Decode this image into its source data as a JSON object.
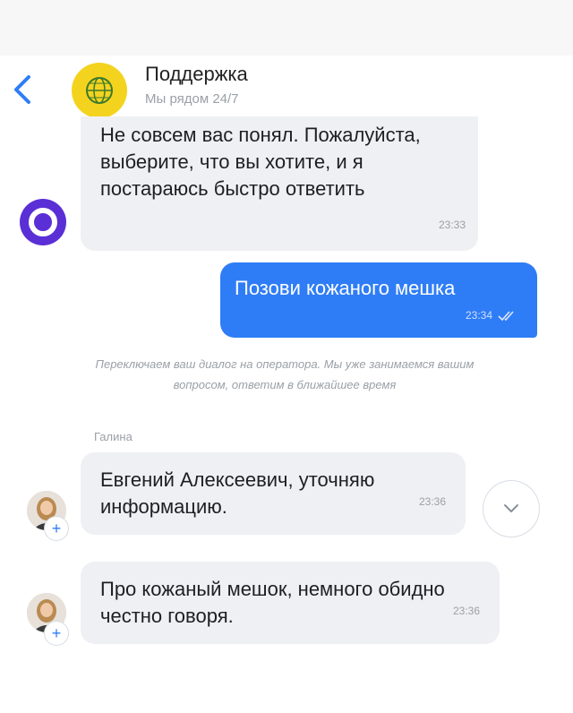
{
  "header": {
    "title": "Поддержка",
    "subtitle": "Мы рядом 24/7"
  },
  "messages": [
    {
      "text": "Не совсем вас понял. Пожалуйста, выберите, что вы хотите, и я постараюсь быстро ответить",
      "time": "23:33"
    },
    {
      "text": "Позови кожаного мешка",
      "time": "23:34"
    },
    {
      "text": "Евгений Алексеевич, уточняю информацию.",
      "time": "23:36"
    },
    {
      "text": "Про кожаный мешок, немного обидно честно говоря.",
      "time": "23:36"
    }
  ],
  "system_note": "Переключаем ваш диалог на оператора. Мы уже занимаемся вашим вопросом, ответим в ближайшее время",
  "operator": {
    "name": "Галина",
    "badge": "+"
  },
  "bot_badge": "O",
  "colors": {
    "accent": "#2f7df6",
    "bubble": "#eff0f3",
    "brand": "#f4d31f",
    "bot": "#5b2fd6"
  },
  "icons": {
    "back": "chevron-left-icon",
    "down": "chevron-down-icon",
    "read": "double-check-icon"
  }
}
